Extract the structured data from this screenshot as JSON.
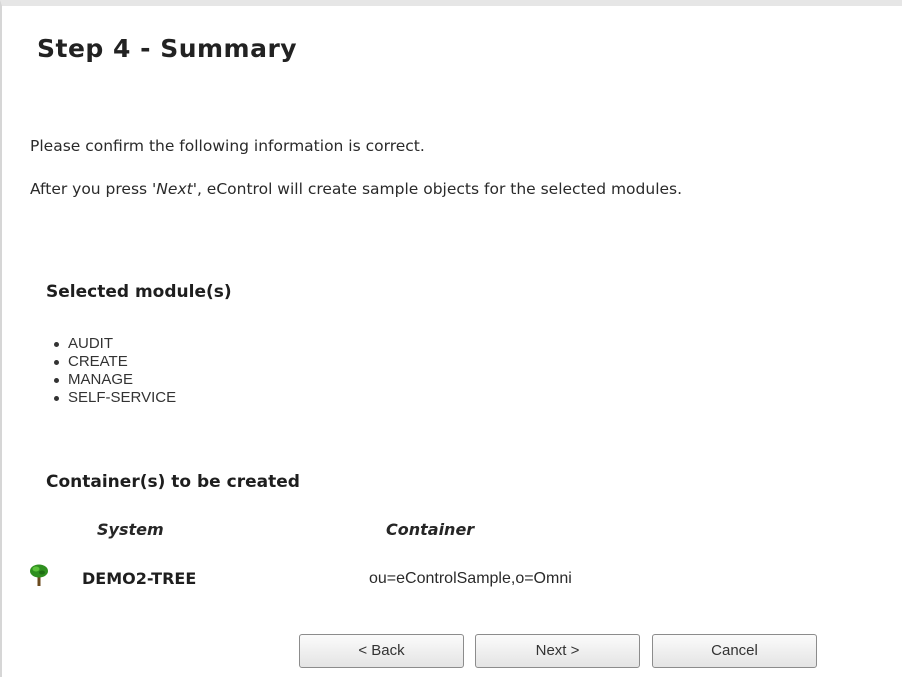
{
  "page": {
    "title": "Step 4 - Summary",
    "intro_line1": "Please confirm the following information is correct.",
    "intro_line2_prefix": "After you press ",
    "intro_line2_emph": "'Next'",
    "intro_line2_suffix": ", eControl will create sample objects for the selected modules."
  },
  "modules": {
    "heading": "Selected module(s)",
    "items": [
      "AUDIT",
      "CREATE",
      "MANAGE",
      "SELF-SERVICE"
    ]
  },
  "containers": {
    "heading": "Container(s) to be created",
    "columns": {
      "system": "System",
      "container": "Container"
    },
    "rows": [
      {
        "icon": "tree-icon",
        "system": "DEMO2-TREE",
        "container": "ou=eControlSample,o=Omni"
      }
    ]
  },
  "buttons": {
    "back": "< Back",
    "next": "Next >",
    "cancel": "Cancel"
  },
  "colors": {
    "tree_foliage": "#2f8f1f",
    "tree_trunk": "#6b4a1e"
  }
}
